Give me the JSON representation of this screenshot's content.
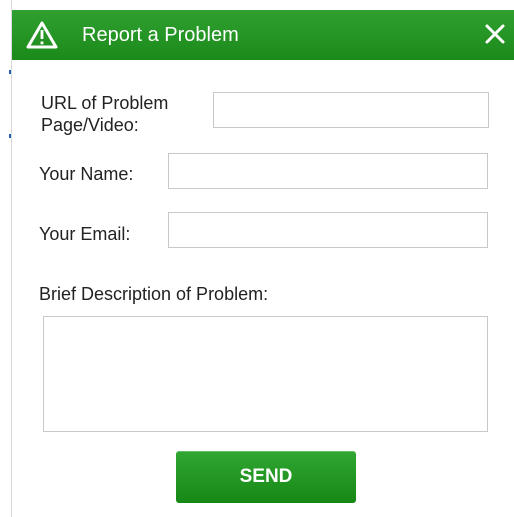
{
  "dialog": {
    "title": "Report a Problem",
    "colors": {
      "header": "#1b8a1b",
      "button": "#1b8a1b",
      "text": "#222222"
    },
    "icons": {
      "title": "warning-icon",
      "close": "close-icon"
    }
  },
  "form": {
    "url_label": "URL of Problem\nPage/Video:",
    "url_value": "",
    "name_label": "Your Name:",
    "name_value": "",
    "email_label": "Your Email:",
    "email_value": "",
    "description_label": "Brief Description of Problem:",
    "description_value": "",
    "send_label": "SEND"
  }
}
